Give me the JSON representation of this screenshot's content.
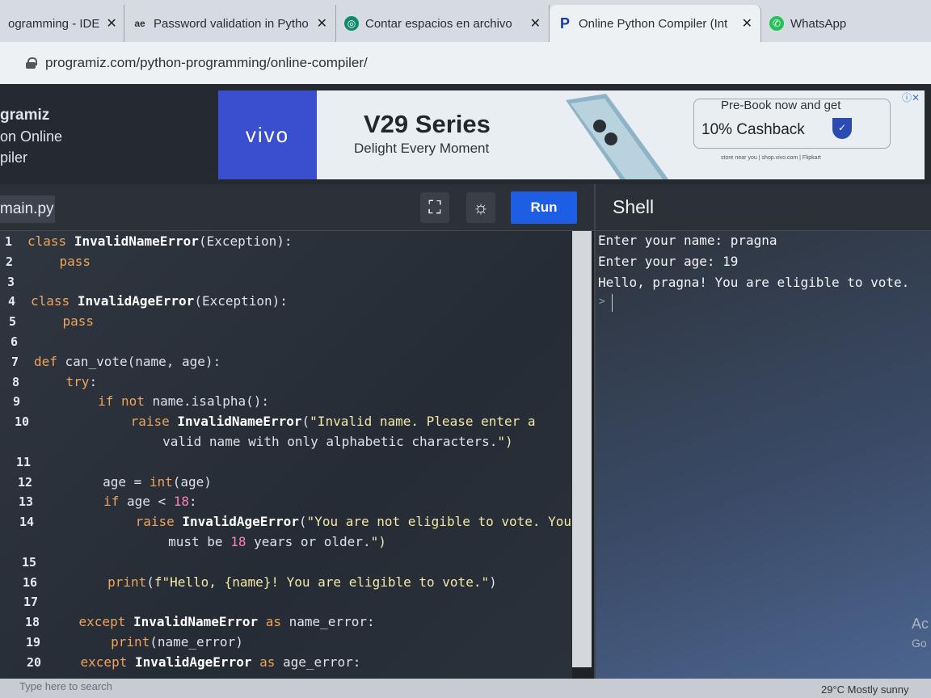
{
  "browser": {
    "tabs": [
      {
        "label": "ogramming - IDE",
        "favicon": "tab-icon"
      },
      {
        "label": "Password validation in Pytho",
        "favicon": "ae"
      },
      {
        "label": "Contar espacios en archivo",
        "favicon": "chatgpt-icon"
      },
      {
        "label": "Online Python Compiler (Int",
        "favicon": "programiz-icon"
      },
      {
        "label": "WhatsApp",
        "favicon": "whatsapp-icon"
      }
    ],
    "close_glyph": "✕",
    "url": "programiz.com/python-programming/online-compiler/"
  },
  "site": {
    "brand_line1": "gramiz",
    "brand_line2": "on Online",
    "brand_line3": "piler"
  },
  "ad": {
    "brand": "vivo",
    "title": "V29 Series",
    "tagline": "Delight Every Moment",
    "pre": "Pre-Book now and get",
    "cashback": "10% Cashback",
    "store": "store near you | shop.vivo.com | Flipkart"
  },
  "editor": {
    "filename": "main.py",
    "run_label": "Run",
    "lines": [
      {
        "n": "1",
        "code": "class InvalidNameError(Exception):"
      },
      {
        "n": "2",
        "code": "    pass"
      },
      {
        "n": "3",
        "code": ""
      },
      {
        "n": "4",
        "code": "class InvalidAgeError(Exception):"
      },
      {
        "n": "5",
        "code": "    pass"
      },
      {
        "n": "6",
        "code": ""
      },
      {
        "n": "7",
        "code": "def can_vote(name, age):"
      },
      {
        "n": "8",
        "code": "    try:"
      },
      {
        "n": "9",
        "code": "        if not name.isalpha():"
      },
      {
        "n": "10",
        "code": "            raise InvalidNameError(\"Invalid name. Please enter a"
      },
      {
        "n": "",
        "code": "                valid name with only alphabetic characters.\")"
      },
      {
        "n": "11",
        "code": ""
      },
      {
        "n": "12",
        "code": "        age = int(age)"
      },
      {
        "n": "13",
        "code": "        if age < 18:"
      },
      {
        "n": "14",
        "code": "            raise InvalidAgeError(\"You are not eligible to vote. You"
      },
      {
        "n": "",
        "code": "                must be 18 years or older.\")"
      },
      {
        "n": "15",
        "code": ""
      },
      {
        "n": "16",
        "code": "        print(f\"Hello, {name}! You are eligible to vote.\")"
      },
      {
        "n": "17",
        "code": ""
      },
      {
        "n": "18",
        "code": "    except InvalidNameError as name_error:"
      },
      {
        "n": "19",
        "code": "        print(name_error)"
      },
      {
        "n": "20",
        "code": "    except InvalidAgeError as age_error:"
      }
    ]
  },
  "shell": {
    "title": "Shell",
    "output": [
      "Enter your name: pragna",
      "Enter your age: 19",
      "Hello, pragna! You are eligible to vote."
    ],
    "prompt": ">"
  },
  "desktop": {
    "watermark1": "Ac",
    "watermark2": "Go",
    "search_placeholder": "Type here to search",
    "weather": "29°C  Mostly sunny"
  }
}
